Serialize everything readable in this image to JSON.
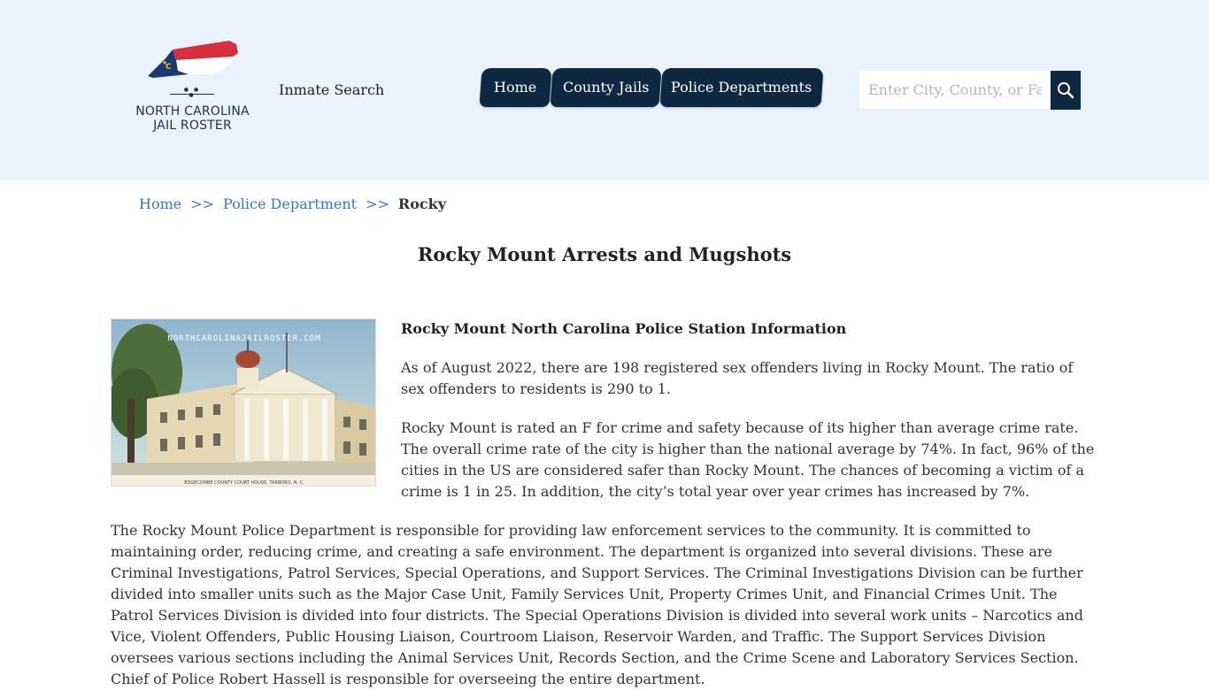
{
  "header": {
    "logo_line1": "NORTH CAROLINA",
    "logo_line2": "JAIL ROSTER",
    "brand_link": "Inmate Search",
    "nav": [
      {
        "label": "Home"
      },
      {
        "label": "County Jails"
      },
      {
        "label": "Police Departments"
      }
    ],
    "search_placeholder": "Enter City, County, or Facility"
  },
  "colors": {
    "header_bg": "#eaf2fe",
    "nav_bg": "#0d2840",
    "link": "#3677cf"
  },
  "breadcrumb": {
    "home": "Home",
    "separator": ">>",
    "section": "Police Department",
    "current": "Rocky"
  },
  "page": {
    "title": "Rocky Mount Arrests and Mugshots",
    "photo_watermark": "NORTHCAROLINAJAILROSTER.COM",
    "photo_caption": "EDGECOMBE COUNTY COURT HOUSE, TARBORO, N. C.",
    "section_heading": "Rocky Mount North Carolina Police Station Information",
    "paragraphs": [
      "As of August 2022, there are 198 registered sex offenders living in Rocky Mount. The ratio of sex offenders to residents is 290 to 1.",
      "Rocky Mount is rated an F for crime and safety because of its higher than average crime rate. The overall crime rate of the city is higher than the national average by 74%. In fact, 96% of the cities in the US are considered safer than Rocky Mount. The chances of becoming a victim of a crime is 1 in 25. In addition, the city’s total year over year crimes has increased by 7%."
    ],
    "full_paragraph": "The Rocky Mount Police Department is responsible for providing law enforcement services to the community. It is committed to maintaining order, reducing crime, and creating a safe environment. The department is organized into several divisions. These are Criminal Investigations, Patrol Services, Special Operations, and Support Services. The Criminal Investigations Division can be further divided into smaller units such as the Major Case Unit, Family Services Unit, Property Crimes Unit, and Financial Crimes Unit. The Patrol Services Division is divided into four districts. The Special Operations Division is divided into several work units – Narcotics and Vice, Violent Offenders, Public Housing Liaison, Courtroom Liaison, Reservoir Warden, and Traffic. The Support Services Division oversees various sections including the Animal Services Unit, Records Section, and the Crime Scene and Laboratory Services Section. Chief of Police Robert Hassell is responsible for overseeing the entire department."
  }
}
